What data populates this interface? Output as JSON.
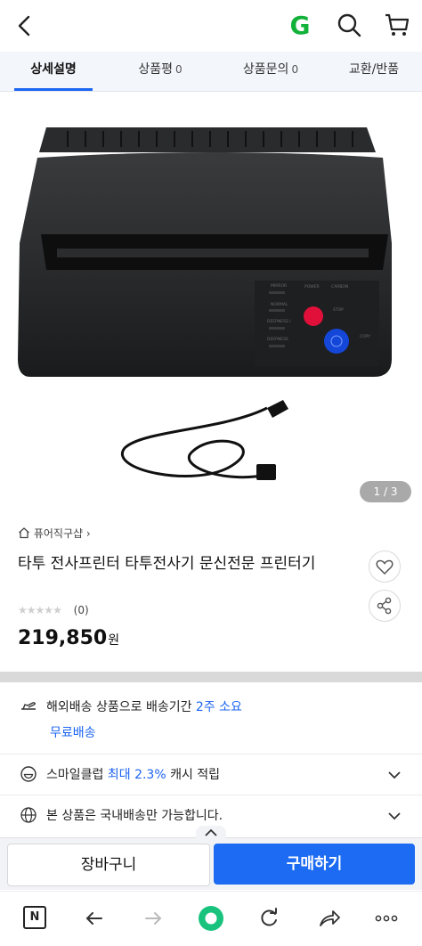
{
  "topbar": {
    "brand_letter": "G"
  },
  "tabs": [
    {
      "label": "상세설명",
      "count": ""
    },
    {
      "label": "상품평",
      "count": "0"
    },
    {
      "label": "상품문의",
      "count": "0"
    },
    {
      "label": "교환/반품",
      "count": ""
    }
  ],
  "gallery": {
    "counter": "1 / 3"
  },
  "product": {
    "seller": "퓨어직구샵 ›",
    "title": "타투 전사프린터 타투전사기 문신전문 프린터기",
    "rating_count": "(0)",
    "price": "219,850",
    "currency": "원",
    "printer_labels": [
      "MIRROR",
      "NORMAL",
      "DEEPNESS I",
      "DEEPNESS",
      "POWER",
      "CARBON",
      "STOP",
      "COPY"
    ]
  },
  "shipping": {
    "prefix": "해외배송 상품으로 배송기간 ",
    "duration": "2주 소요",
    "free": "무료배송"
  },
  "smile": {
    "prefix": "스마일클럽 ",
    "highlight": "최대 2.3%",
    "suffix": " 캐시 적립"
  },
  "notice": {
    "text": "본 상품은 국내배송만 가능합니다."
  },
  "actions": {
    "cart_label": "장바구니",
    "buy_label": "구매하기"
  },
  "browser": {
    "n_label": "N"
  },
  "colors": {
    "accent": "#1c64f2",
    "brand_green": "#12b13a",
    "browser_green": "#19c37d"
  }
}
